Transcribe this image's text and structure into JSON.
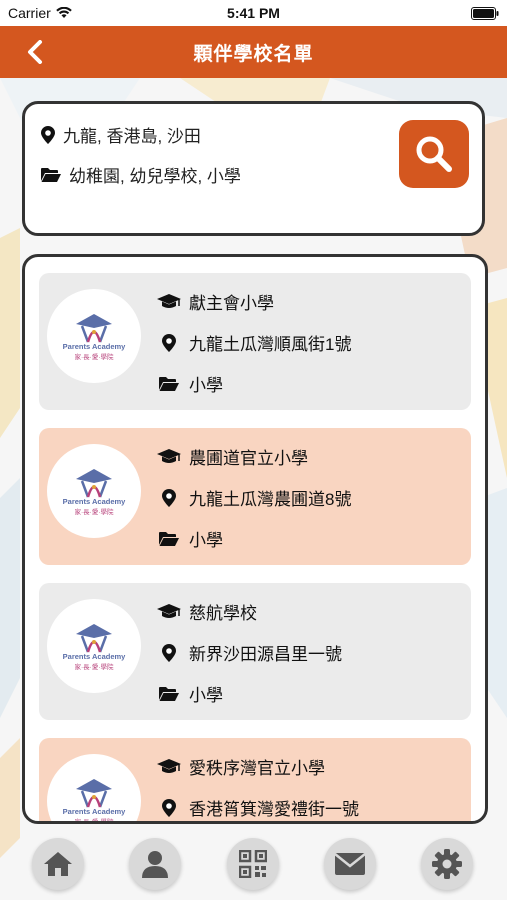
{
  "status_bar": {
    "carrier": "Carrier",
    "time": "5:41 PM"
  },
  "nav": {
    "title": "顆伴學校名單"
  },
  "filters": {
    "regions": "九龍, 香港島, 沙田",
    "school_types": "幼稚園, 幼兒學校, 小學"
  },
  "logo": {
    "en": "Parents Academy",
    "zh": "家·長·愛·學院"
  },
  "schools": [
    {
      "name": "獻主會小學",
      "address": "九龍土瓜灣順風街1號",
      "type": "小學",
      "style": "gray"
    },
    {
      "name": "農圃道官立小學",
      "address": "九龍土瓜灣農圃道8號",
      "type": "小學",
      "style": "peach"
    },
    {
      "name": "慈航學校",
      "address": "新界沙田源昌里一號",
      "type": "小學",
      "style": "gray"
    },
    {
      "name": "愛秩序灣官立小學",
      "address": "香港筲箕灣愛禮街一號",
      "type": "小學",
      "style": "peach"
    }
  ],
  "colors": {
    "accent": "#d4571f",
    "item_gray": "#ebebeb",
    "item_peach": "#f9d5c1"
  },
  "tabs": [
    "home-icon",
    "user-icon",
    "qr-code-icon",
    "mail-icon",
    "settings-icon"
  ]
}
